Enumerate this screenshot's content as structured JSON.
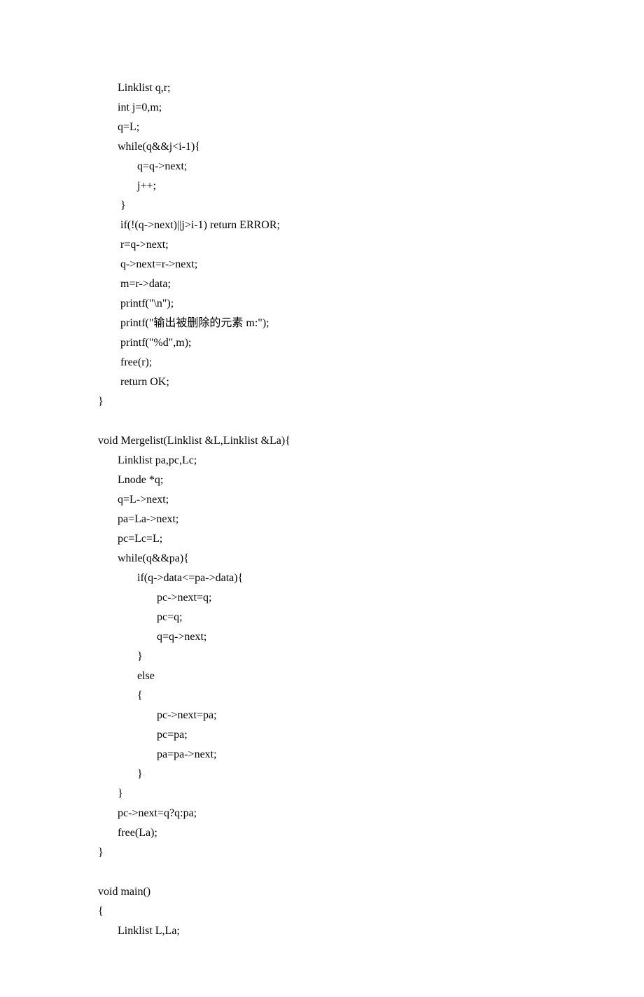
{
  "code_lines": [
    "       Linklist q,r;",
    "       int j=0,m;",
    "       q=L;",
    "       while(q&&j<i-1){",
    "              q=q->next;",
    "              j++;",
    "        }",
    "        if(!(q->next)||j>i-1) return ERROR;",
    "        r=q->next;",
    "        q->next=r->next;",
    "        m=r->data;",
    "        printf(\"\\n\");",
    "        printf(\"输出被删除的元素 m:\");",
    "        printf(\"%d\",m);",
    "        free(r);",
    "        return OK;",
    "}",
    "",
    "void Mergelist(Linklist &L,Linklist &La){",
    "       Linklist pa,pc,Lc;",
    "       Lnode *q;",
    "       q=L->next;",
    "       pa=La->next;",
    "       pc=Lc=L;",
    "       while(q&&pa){",
    "              if(q->data<=pa->data){",
    "                     pc->next=q;",
    "                     pc=q;",
    "                     q=q->next;",
    "              }",
    "              else",
    "              {",
    "                     pc->next=pa;",
    "                     pc=pa;",
    "                     pa=pa->next;",
    "              }",
    "       }",
    "       pc->next=q?q:pa;",
    "       free(La);",
    "}",
    "",
    "void main()",
    "{",
    "       Linklist L,La;"
  ]
}
